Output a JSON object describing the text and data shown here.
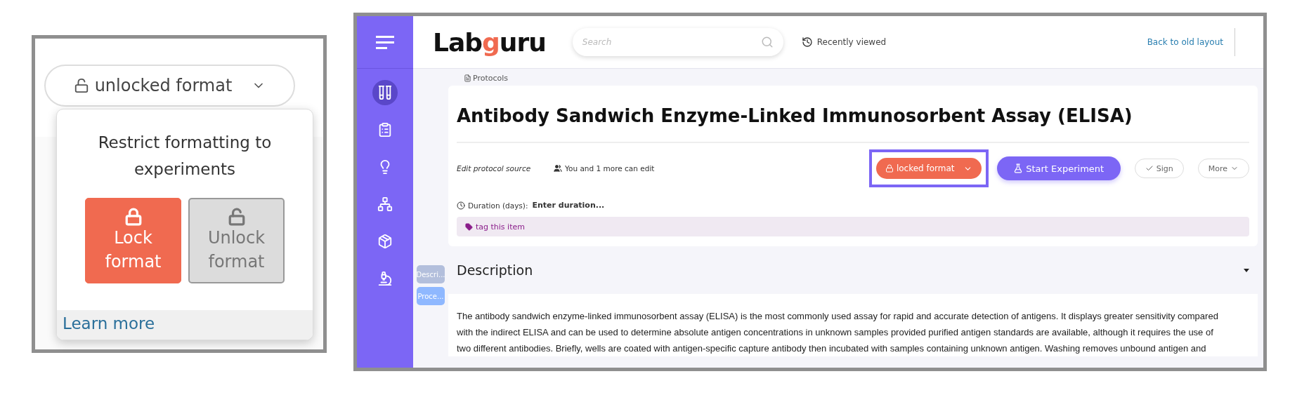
{
  "format_menu": {
    "button": {
      "label": "unlocked format",
      "locked": false
    },
    "popover": {
      "title": "Restrict formatting to experiments",
      "options": [
        {
          "kind": "lock",
          "label": "Lock format",
          "selected": true
        },
        {
          "kind": "unlock",
          "label": "Unlock format",
          "selected": false
        }
      ],
      "link": "Learn more"
    }
  },
  "app": {
    "logo": "Labguru",
    "search": {
      "placeholder": "Search"
    },
    "recently_viewed": "Recently viewed",
    "back_link": "Back to old layout",
    "sidebar": {
      "items": [
        {
          "kind": "samples",
          "selected": true
        },
        {
          "kind": "tasks",
          "selected": false
        },
        {
          "kind": "ideas",
          "selected": false
        },
        {
          "kind": "network",
          "selected": false
        },
        {
          "kind": "box",
          "selected": false
        },
        {
          "kind": "microscope",
          "selected": false
        }
      ]
    },
    "breadcrumb": "Protocols",
    "title": "Antibody Sandwich Enzyme-Linked Immunosorbent Assay (ELISA)",
    "edit_source": "Edit protocol source",
    "editors": "You and 1 more can edit",
    "format_button": {
      "label": "locked format",
      "locked": true,
      "highlighted": true
    },
    "start_button": "Start Experiment",
    "sign_button": "Sign",
    "more_button": "More",
    "duration": {
      "label": "Duration (days):",
      "placeholder": "Enter duration..."
    },
    "tag": "tag this item",
    "section_tabs": [
      {
        "label": "Descri...",
        "selected": true
      },
      {
        "label": "Proce...",
        "selected": false
      }
    ],
    "section_title": "Description",
    "paragraph_lines": [
      "The antibody sandwich enzyme-linked immunosorbent assay (ELISA) is the most commonly used assay for rapid and accurate detection of antigens. It displays greater sensitivity compared",
      "with the indirect ELISA and can be used to determine absolute antigen concentrations in unknown samples provided purified antigen standards are available, although it requires the use of",
      "two different antibodies. Briefly, wells are coated with antigen-specific capture antibody then incubated with samples containing unknown antigen. Washing removes unbound antigen and"
    ]
  }
}
